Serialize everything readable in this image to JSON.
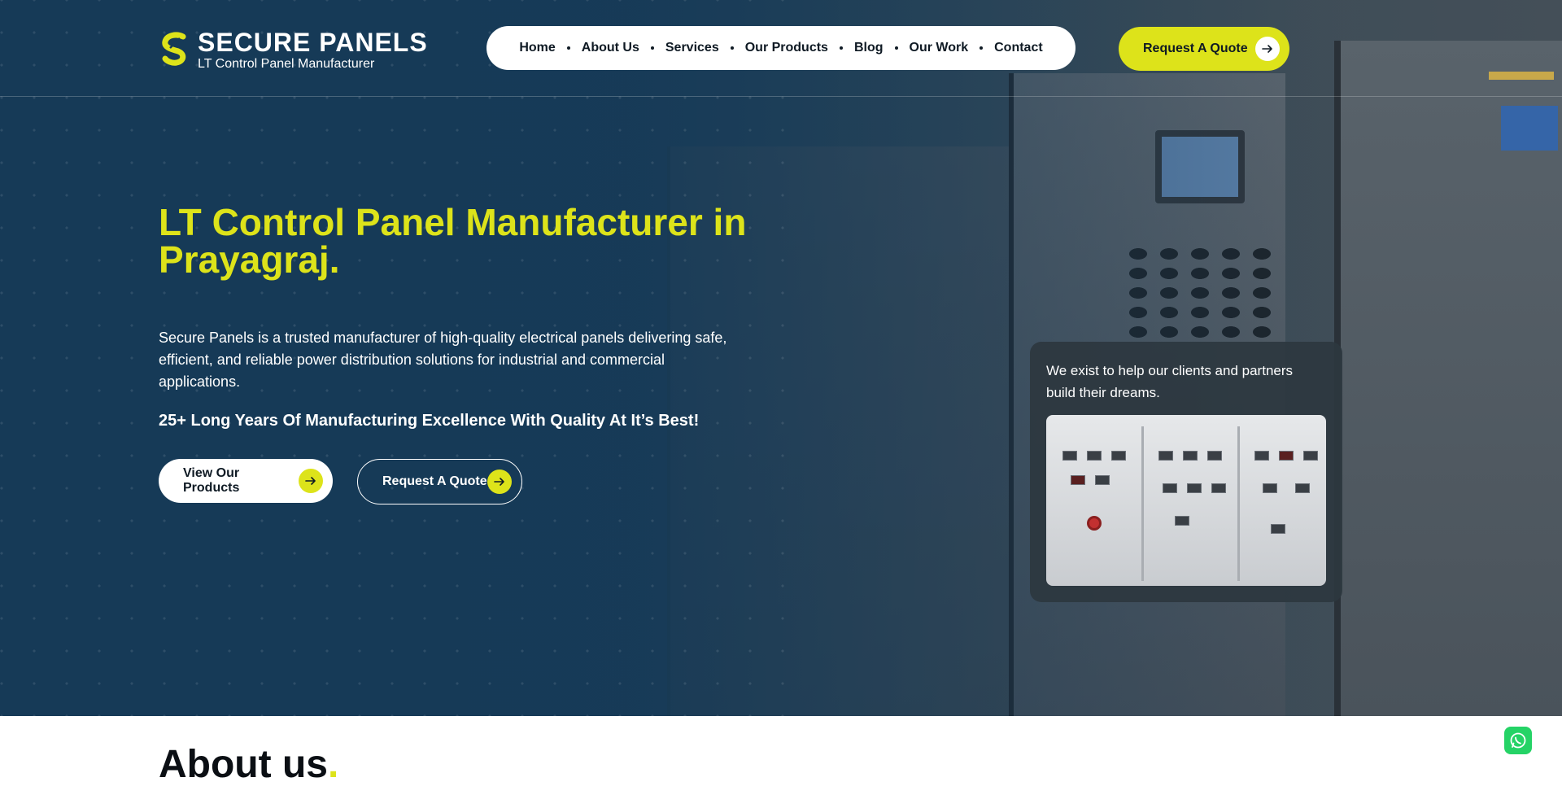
{
  "brand": {
    "name": "SECURE PANELS",
    "tagline": "LT Control Panel Manufacturer",
    "accent": "#dde31a",
    "navy": "#163a57"
  },
  "nav": {
    "items": [
      "Home",
      "About Us",
      "Services",
      "Our Products",
      "Blog",
      "Our Work",
      "Contact"
    ]
  },
  "header": {
    "quote_label": "Request A Quote"
  },
  "hero": {
    "title": "LT Control Panel Manufacturer in Prayagraj.",
    "description": "Secure Panels is a trusted manufacturer of high-quality electrical panels delivering safe, efficient, and reliable power distribution solutions for industrial and commercial applications.",
    "tagline": "25+ Long Years Of Manufacturing Excellence With Quality At It’s Best!",
    "products_button": "View Our Products",
    "quote_button": "Request A Quote"
  },
  "card": {
    "text": "We exist to help our clients and partners build their dreams."
  },
  "about": {
    "heading": "About us",
    "dot": "."
  },
  "icons": [
    "logo-mark-icon",
    "arrow-right-icon",
    "whatsapp-icon"
  ]
}
